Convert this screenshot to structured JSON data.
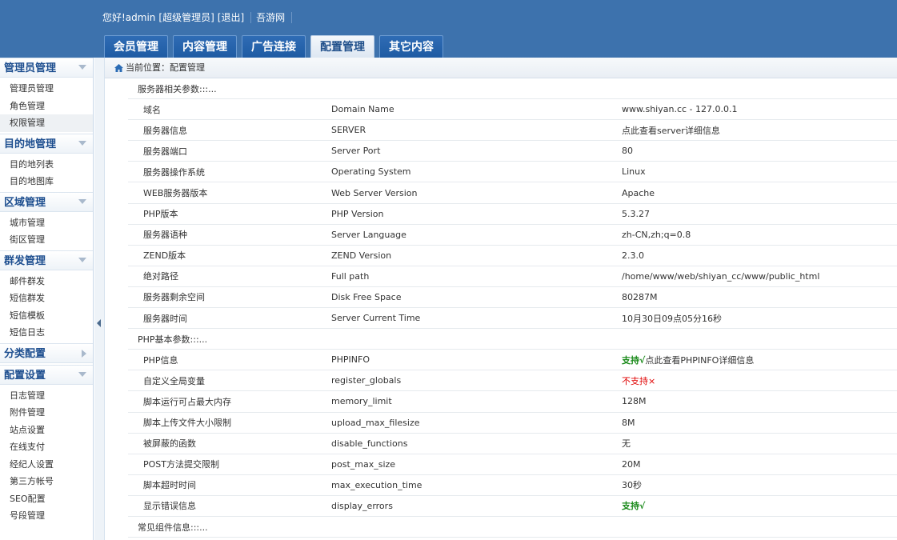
{
  "header": {
    "greeting": "您好!admin",
    "role": "[超级管理员]",
    "logout": "[退出]",
    "site": "吾游网"
  },
  "tabs": [
    {
      "label": "会员管理"
    },
    {
      "label": "内容管理"
    },
    {
      "label": "广告连接"
    },
    {
      "label": "配置管理",
      "active": true
    },
    {
      "label": "其它内容"
    }
  ],
  "sidebar": [
    {
      "title": "管理员管理",
      "items": [
        "管理员管理",
        "角色管理",
        "权限管理"
      ]
    },
    {
      "title": "目的地管理",
      "items": [
        "目的地列表",
        "目的地图库"
      ]
    },
    {
      "title": "区域管理",
      "items": [
        "城市管理",
        "街区管理"
      ]
    },
    {
      "title": "群发管理",
      "items": [
        "邮件群发",
        "短信群发",
        "短信模板",
        "短信日志"
      ]
    },
    {
      "title": "分类配置",
      "items": []
    },
    {
      "title": "配置设置",
      "items": [
        "日志管理",
        "附件管理",
        "站点设置",
        "在线支付",
        "经纪人设置",
        "第三方帐号",
        "SEO配置",
        "号段管理"
      ]
    }
  ],
  "breadcrumb": "当前位置：配置管理",
  "sections": {
    "server": "服务器相关参数:::...",
    "php": "PHP基本参数:::...",
    "components": "常见组件信息:::..."
  },
  "server_rows": [
    {
      "name": "域名",
      "key": "Domain Name",
      "value": "www.shiyan.cc - 127.0.0.1"
    },
    {
      "name": "服务器信息",
      "key": "SERVER",
      "value": "点此查看server详细信息"
    },
    {
      "name": "服务器端口",
      "key": "Server Port",
      "value": "80"
    },
    {
      "name": "服务器操作系统",
      "key": "Operating System",
      "value": "Linux"
    },
    {
      "name": "WEB服务器版本",
      "key": "Web Server Version",
      "value": "Apache"
    },
    {
      "name": "PHP版本",
      "key": "PHP Version",
      "value": "5.3.27"
    },
    {
      "name": "服务器语种",
      "key": "Server Language",
      "value": "zh-CN,zh;q=0.8"
    },
    {
      "name": "ZEND版本",
      "key": "ZEND Version",
      "value": "2.3.0"
    },
    {
      "name": "绝对路径",
      "key": "Full path",
      "value": "/home/www/web/shiyan_cc/www/public_html"
    },
    {
      "name": "服务器剩余空间",
      "key": "Disk Free Space",
      "value": "80287M"
    },
    {
      "name": "服务器时间",
      "key": "Server Current Time",
      "value": "10月30日09点05分16秒"
    }
  ],
  "php_rows": [
    {
      "name": "PHP信息",
      "key": "PHPINFO",
      "status": "支持√",
      "value": "点此查看PHPINFO详细信息"
    },
    {
      "name": "自定义全局变量",
      "key": "register_globals",
      "status_red": "不支持×"
    },
    {
      "name": "脚本运行可占最大内存",
      "key": "memory_limit",
      "value": "128M"
    },
    {
      "name": "脚本上传文件大小限制",
      "key": "upload_max_filesize",
      "value": "8M"
    },
    {
      "name": "被屏蔽的函数",
      "key": "disable_functions",
      "value": "无"
    },
    {
      "name": "POST方法提交限制",
      "key": "post_max_size",
      "value": "20M"
    },
    {
      "name": "脚本超时时间",
      "key": "max_execution_time",
      "value": "30秒"
    },
    {
      "name": "显示错误信息",
      "key": "display_errors",
      "status": "支持√"
    }
  ],
  "colors": {
    "header_bg": "#3d72ad",
    "support_green": "#1a8a1a",
    "unsupported_red": "#e00000"
  }
}
